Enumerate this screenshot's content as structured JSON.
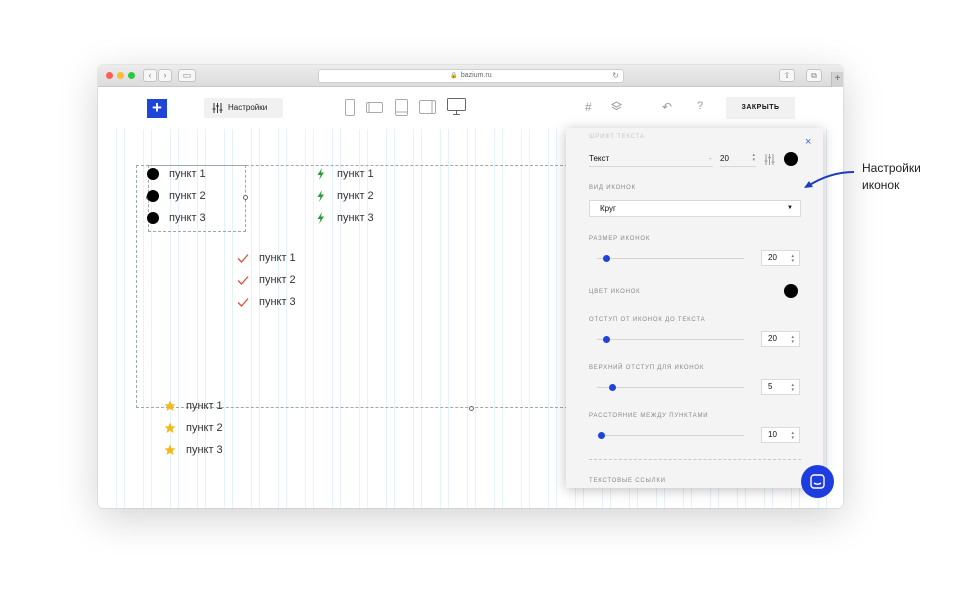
{
  "browser": {
    "url": "bazium.ru",
    "back_label": "‹",
    "forward_label": "›",
    "sidebar_label": "▭",
    "reload_label": "↻",
    "share_label": "⇧",
    "tabs_label": "⧉",
    "new_tab_label": "+"
  },
  "toolbar": {
    "add_label": "+",
    "settings_label": "Настройки",
    "grid_label": "#",
    "undo_label": "↶",
    "help_label": "?",
    "close_label": "ЗАКРЫТЬ",
    "devices": [
      "phone-portrait-icon",
      "phone-landscape-icon",
      "tablet-portrait-icon",
      "tablet-landscape-icon",
      "desktop-icon"
    ]
  },
  "lists": {
    "circle": [
      "пункт 1",
      "пункт 2",
      "пункт 3"
    ],
    "bolt": [
      "пункт 1",
      "пункт 2",
      "пункт 3"
    ],
    "check": [
      "пункт 1",
      "пункт 2",
      "пункт 3"
    ],
    "star": [
      "пункт 1",
      "пункт 2",
      "пункт 3"
    ]
  },
  "icon_colors": {
    "circle": "#000000",
    "bolt": "#2e9b3a",
    "check": "#e0513c",
    "star": "#f5b91a"
  },
  "panel": {
    "close_label": "×",
    "font_caption": "ШРИФТ ТЕКСТА",
    "font_name": "Текст",
    "font_dash": "-",
    "font_size": "20",
    "icon_type_caption": "ВИД ИКОНОК",
    "icon_type_value": "Круг",
    "icon_size_caption": "РАЗМЕР ИКОНОК",
    "icon_size_value": "20",
    "icon_color_caption": "ЦВЕТ ИКОНОК",
    "icon_text_gap_caption": "ОТСТУП ОТ ИКОНОК ДО ТЕКСТА",
    "icon_text_gap_value": "20",
    "icon_top_caption": "ВЕРХНИЙ ОТСТУП ДЛЯ ИКОНОК",
    "icon_top_value": "5",
    "item_gap_caption": "РАССТОЯНИЕ МЕЖДУ ПУНКТАМИ",
    "item_gap_value": "10",
    "links_caption": "ТЕКСТОВЫЕ ССЫЛКИ",
    "sliders": {
      "icon_size": 0.06,
      "icon_text_gap": 0.06,
      "icon_top": 0.1,
      "item_gap": 0.03
    },
    "spinner_label": "⌃⌄",
    "accent": "#1e45d7"
  },
  "annotation": {
    "line1": "Настройки",
    "line2": "иконок"
  }
}
